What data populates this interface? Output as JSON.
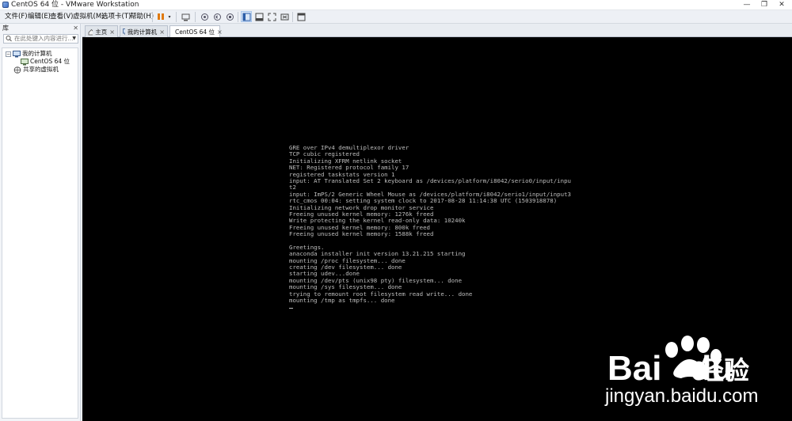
{
  "window": {
    "title": "CentOS 64 位 - VMware Workstation"
  },
  "menu": [
    "文件(F)",
    "编辑(E)",
    "查看(V)",
    "虚拟机(M)",
    "选项卡(T)",
    "帮助(H)"
  ],
  "toolbar_icons": [
    "pause-icon",
    "send-ctrl-alt-del-icon",
    "snapshot-icon",
    "revert-snapshot-icon",
    "manage-snapshots-icon",
    "library-view-icon",
    "thumbnail-view-icon",
    "fullscreen-icon",
    "unity-icon",
    "console-view-icon"
  ],
  "library": {
    "title": "库",
    "search_placeholder": "在此处键入内容进行...",
    "tree": {
      "my_computer": "我的计算机",
      "vm": "CentOS 64 位",
      "shared": "共享的虚拟机"
    }
  },
  "tabs": [
    {
      "label": "主页",
      "icon": "home-icon"
    },
    {
      "label": "我的计算机",
      "icon": "computer-icon"
    },
    {
      "label": "CentOS 64 位",
      "icon": "vm-icon",
      "active": true
    }
  ],
  "console": {
    "lines": [
      "GRE over IPv4 demultiplexor driver",
      "TCP cubic registered",
      "Initializing XFRM netlink socket",
      "NET: Registered protocol family 17",
      "registered taskstats version 1",
      "input: AT Translated Set 2 keyboard as /devices/platform/i8042/serio0/input/inpu",
      "t2",
      "input: ImPS/2 Generic Wheel Mouse as /devices/platform/i8042/serio1/input/input3",
      "rtc_cmos 00:04: setting system clock to 2017-08-28 11:14:38 UTC (1503918878)",
      "Initializing network drop monitor service",
      "Freeing unused kernel memory: 1276k freed",
      "Write protecting the kernel read-only data: 10240k",
      "Freeing unused kernel memory: 800k freed",
      "Freeing unused kernel memory: 1588k freed",
      "",
      "Greetings.",
      "anaconda installer init version 13.21.215 starting",
      "mounting /proc filesystem... done",
      "creating /dev filesystem... done",
      "starting udev...done",
      "mounting /dev/pts (unix98 pty) filesystem... done",
      "mounting /sys filesystem... done",
      "trying to remount root filesystem read write... done",
      "mounting /tmp as tmpfs... done"
    ]
  },
  "watermark": {
    "brand": "Bai",
    "brand_tail": "du",
    "cn": "经验",
    "url": "jingyan.baidu.com"
  }
}
